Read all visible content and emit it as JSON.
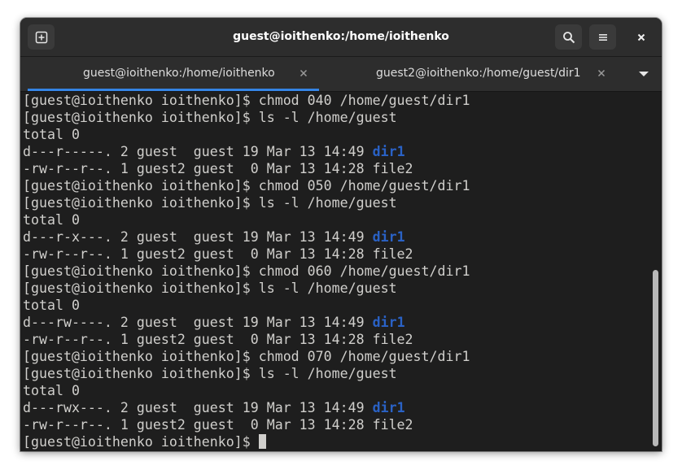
{
  "window": {
    "title": "guest@ioithenko:/home/ioithenko"
  },
  "headerbar": {
    "new_tab_icon": "new-tab-icon",
    "search_icon": "search-icon",
    "menu_icon": "hamburger-menu-icon",
    "close_icon": "close-icon"
  },
  "tabs": [
    {
      "label": "guest@ioithenko:/home/ioithenko",
      "active": true
    },
    {
      "label": "guest2@ioithenko:/home/guest/dir1",
      "active": false
    }
  ],
  "terminal": {
    "lines": [
      {
        "text": "[guest@ioithenko ioithenko]$ chmod 040 /home/guest/dir1"
      },
      {
        "text": "[guest@ioithenko ioithenko]$ ls -l /home/guest"
      },
      {
        "text": "total 0"
      },
      {
        "text": "d---r-----. 2 guest  guest 19 Mar 13 14:49 ",
        "link": "dir1"
      },
      {
        "text": "-rw-r--r--. 1 guest2 guest  0 Mar 13 14:28 file2"
      },
      {
        "text": "[guest@ioithenko ioithenko]$ chmod 050 /home/guest/dir1"
      },
      {
        "text": "[guest@ioithenko ioithenko]$ ls -l /home/guest"
      },
      {
        "text": "total 0"
      },
      {
        "text": "d---r-x---. 2 guest  guest 19 Mar 13 14:49 ",
        "link": "dir1"
      },
      {
        "text": "-rw-r--r--. 1 guest2 guest  0 Mar 13 14:28 file2"
      },
      {
        "text": "[guest@ioithenko ioithenko]$ chmod 060 /home/guest/dir1"
      },
      {
        "text": "[guest@ioithenko ioithenko]$ ls -l /home/guest"
      },
      {
        "text": "total 0"
      },
      {
        "text": "d---rw----. 2 guest  guest 19 Mar 13 14:49 ",
        "link": "dir1"
      },
      {
        "text": "-rw-r--r--. 1 guest2 guest  0 Mar 13 14:28 file2"
      },
      {
        "text": "[guest@ioithenko ioithenko]$ chmod 070 /home/guest/dir1"
      },
      {
        "text": "[guest@ioithenko ioithenko]$ ls -l /home/guest"
      },
      {
        "text": "total 0"
      },
      {
        "text": "d---rwx---. 2 guest  guest 19 Mar 13 14:49 ",
        "link": "dir1"
      },
      {
        "text": "-rw-r--r--. 1 guest2 guest  0 Mar 13 14:28 file2"
      },
      {
        "text": "[guest@ioithenko ioithenko]$ ",
        "cursor": true
      }
    ],
    "scroll_position": 0.5
  },
  "colors": {
    "background": "#1e1e1e",
    "foreground": "#d0cfcc",
    "directory": "#2a62c6",
    "accent": "#3584e4",
    "headerbar": "#2d2d2d"
  }
}
